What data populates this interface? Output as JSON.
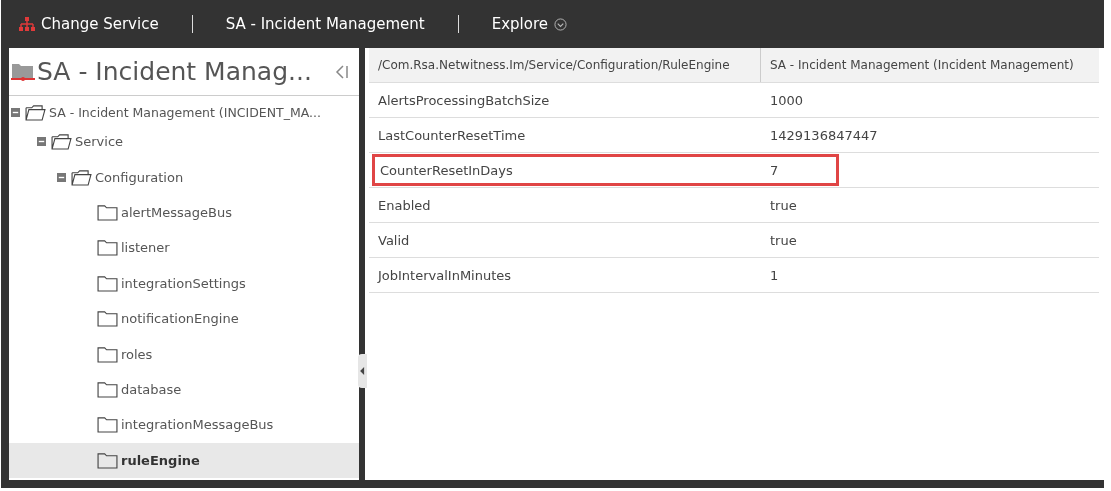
{
  "topbar": {
    "items": [
      {
        "kind": "service",
        "label": "Change Service"
      },
      {
        "kind": "title",
        "label": "SA - Incident Management"
      },
      {
        "kind": "menu",
        "label": "Explore"
      }
    ]
  },
  "sidebar": {
    "title": "SA - Incident Manag...",
    "tree": [
      {
        "label": "SA - Incident Management (INCIDENT_MA...",
        "expanded": true,
        "selected": false,
        "children": [
          {
            "label": "Service",
            "expanded": true,
            "selected": false,
            "children": [
              {
                "label": "Configuration",
                "expanded": true,
                "selected": false,
                "children": [
                  {
                    "label": "alertMessageBus",
                    "selected": false
                  },
                  {
                    "label": "listener",
                    "selected": false
                  },
                  {
                    "label": "integrationSettings",
                    "selected": false
                  },
                  {
                    "label": "notificationEngine",
                    "selected": false
                  },
                  {
                    "label": "roles",
                    "selected": false
                  },
                  {
                    "label": "database",
                    "selected": false
                  },
                  {
                    "label": "integrationMessageBus",
                    "selected": false
                  },
                  {
                    "label": "ruleEngine",
                    "selected": true
                  }
                ]
              }
            ]
          }
        ]
      }
    ]
  },
  "table": {
    "columns": [
      "/Com.Rsa.Netwitness.Im/Service/Configuration/RuleEngine",
      "SA - Incident Management (Incident Management)"
    ],
    "rows": [
      {
        "name": "AlertsProcessingBatchSize",
        "value": "1000",
        "highlighted": false
      },
      {
        "name": "LastCounterResetTime",
        "value": "1429136847447",
        "highlighted": false
      },
      {
        "name": "CounterResetInDays",
        "value": "7",
        "highlighted": true
      },
      {
        "name": "Enabled",
        "value": "true",
        "highlighted": false
      },
      {
        "name": "Valid",
        "value": "true",
        "highlighted": false
      },
      {
        "name": "JobIntervalInMinutes",
        "value": "1",
        "highlighted": false
      }
    ]
  }
}
